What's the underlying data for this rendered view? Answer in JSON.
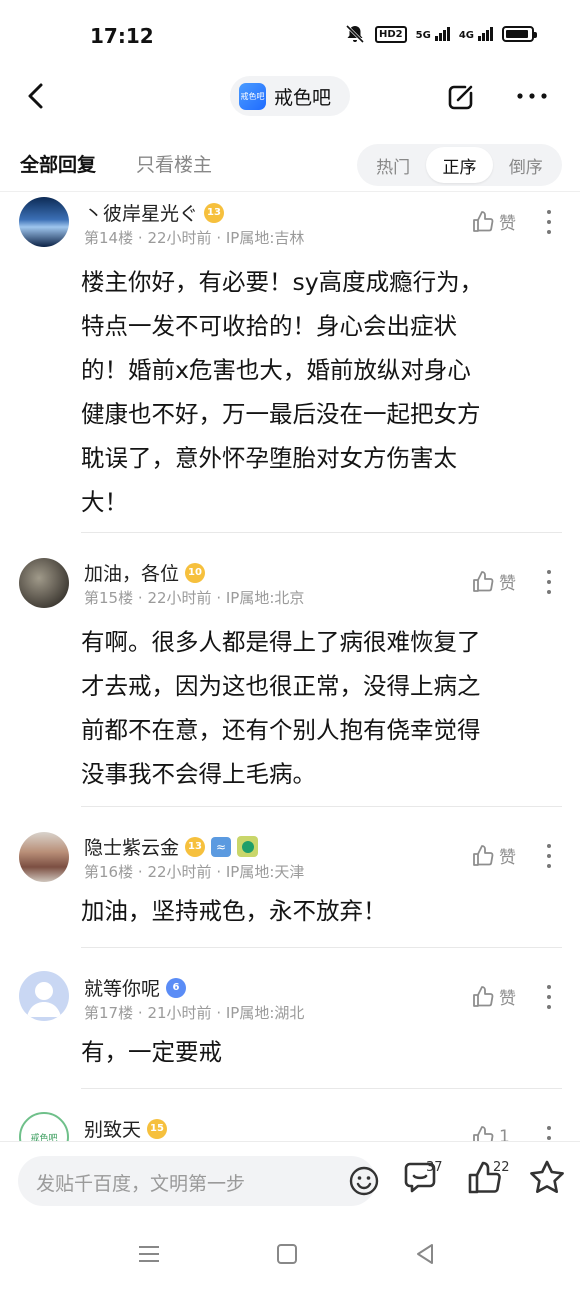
{
  "status": {
    "time": "17:12",
    "hd": "HD2",
    "net1": "5G",
    "net2": "4G",
    "battery_level": 0.9
  },
  "header": {
    "forum_name": "戒色吧",
    "forum_logo_text": "戒色吧"
  },
  "filters": {
    "all_replies": "全部回复",
    "only_host": "只看楼主",
    "sort": [
      "热门",
      "正序",
      "倒序"
    ],
    "sort_active": "正序"
  },
  "posts": [
    {
      "username": "丶彼岸星光ぐ",
      "level": "13",
      "floor": "第14楼",
      "time": "22小时前",
      "ip": "IP属地:吉林",
      "like_label": "赞",
      "lines": [
        "楼主你好，有必要！sy高度成瘾行为，",
        "特点一发不可收拾的！身心会出症状",
        "的！婚前x危害也大，婚前放纵对身心",
        "健康也不好，万一最后没在一起把女方",
        "耽误了，意外怀孕堕胎对女方伤害太",
        "大！"
      ]
    },
    {
      "username": "加油，各位",
      "level": "10",
      "floor": "第15楼",
      "time": "22小时前",
      "ip": "IP属地:北京",
      "like_label": "赞",
      "lines": [
        "有啊。很多人都是得上了病很难恢复了",
        "才去戒，因为这也很正常，没得上病之",
        "前都不在意，还有个别人抱有侥幸觉得",
        "没事我不会得上毛病。"
      ]
    },
    {
      "username": "隐士紫云金",
      "level": "13",
      "floor": "第16楼",
      "time": "22小时前",
      "ip": "IP属地:天津",
      "like_label": "赞",
      "lines": [
        "加油，坚持戒色，永不放弃！"
      ]
    },
    {
      "username": "就等你呢",
      "level": "6",
      "floor": "第17楼",
      "time": "21小时前",
      "ip": "IP属地:湖北",
      "like_label": "赞",
      "lines": [
        "有，一定要戒"
      ]
    },
    {
      "username": "别致天",
      "level": "15",
      "avatar_text": "戒色吧",
      "like_label": "1"
    }
  ],
  "meta_sep": "·",
  "bottom": {
    "reply_placeholder": "发贴千百度，文明第一步",
    "comment_count": "37",
    "like_count": "22"
  },
  "colors": {
    "accent": "#1f6bff",
    "level_badge": "#f6c03d",
    "level_badge_blue": "#5a8cf6"
  }
}
